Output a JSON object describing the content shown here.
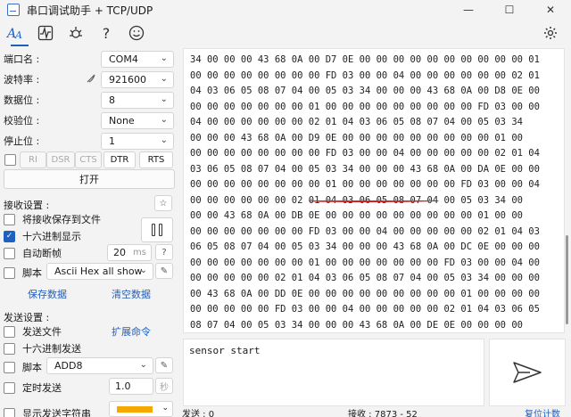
{
  "window": {
    "title": "串口调试助手 + TCP/UDP",
    "minimize": "—",
    "maximize": "☐",
    "close": "✕"
  },
  "toolbar": {
    "text_icon": "AA",
    "wave_icon": "∿",
    "plugin_icon": "✿",
    "help": "?",
    "smile": "☺",
    "settings": "⚙"
  },
  "serial": {
    "port_label": "端口名 :",
    "port_value": "COM4",
    "baud_label": "波特率 :",
    "baud_value": "921600",
    "data_label": "数据位 :",
    "data_value": "8",
    "parity_label": "校验位 :",
    "parity_value": "None",
    "stop_label": "停止位 :",
    "stop_value": "1",
    "ri": "RI",
    "dsr": "DSR",
    "cts": "CTS",
    "dtr": "DTR",
    "rts": "RTS",
    "open_btn": "打开"
  },
  "receive": {
    "title": "接收设置 :",
    "save_to_file": "将接收保存到文件",
    "hex_display": "十六进制显示",
    "auto_frame": "自动断帧",
    "frame_ms": "20",
    "frame_unit": "ms",
    "help": "?",
    "script": "脚本",
    "script_value": "Ascii Hex all show",
    "save_data": "保存数据",
    "clear_data": "清空数据"
  },
  "send": {
    "title": "发送设置 :",
    "send_file": "发送文件",
    "expand_cmd": "扩展命令",
    "hex_send": "十六进制发送",
    "script": "脚本",
    "script_value": "ADD8",
    "timed_send": "定时发送",
    "timed_value": "1.0",
    "timed_unit": "秒",
    "show_send_str": "显示发送字符串",
    "input_text": "sensor start"
  },
  "hex_lines": [
    "34 00 00 00 43 68 0A 00 D7 0E 00 00 00 00 00 00 00 00 00 00 01",
    "00 00 00 00 00 00 00 00 FD 03 00 00 04 00 00 00 00 00 00 02 01",
    "04 03 06 05 08 07 04 00 05 03 34 00 00 00 43 68 0A 00 D8 0E 00",
    "00 00 00 00 00 00 00 01 00 00 00 00 00 00 00 00 00 FD 03 00 00",
    "04 00 00 00 00 00 00 02 01 04 03 06 05 08 07 04 00 05 03 34",
    "00 00 00 43 68 0A 00 D9 0E 00 00 00 00 00 00 00 00 00 01 00",
    "00 00 00 00 00 00 00 00 FD 03 00 00 04 00 00 00 00 00 02 01 04",
    "03 06 05 08 07 04 00 05 03 34 00 00 00 43 68 0A 00 DA 0E 00 00",
    "00 00 00 00 00 00 00 00 01 00 00 00 00 00 00 00 FD 03 00 00 04",
    "00 00 00 00 00 00 02 01 04 03 06 05 08 07 04 00 05 03 34 00",
    "00 00 43 68 0A 00 DB 0E 00 00 00 00 00 00 00 00 00 01 00 00",
    "00 00 00 00 00 00 00 FD 03 00 00 04 00 00 00 00 00 02 01 04 03",
    "06 05 08 07 04 00 05 03 34 00 00 00 43 68 0A 00 DC 0E 00 00 00",
    "00 00 00 00 00 00 00 01 00 00 00 00 00 00 00 FD 03 00 00 04 00",
    "00 00 00 00 00 02 01 04 03 06 05 08 07 04 00 05 03 34 00 00 00",
    "00 43 68 0A 00 DD 0E 00 00 00 00 00 00 00 00 00 01 00 00 00 00",
    "00 00 00 00 00 FD 03 00 00 04 00 00 00 00 00 02 01 04 03 06 05",
    "08 07 04 00 05 03 34 00 00 00 43 68 0A 00 DE 0E 00 00 00 00"
  ],
  "status": {
    "sent": "发送 : 0",
    "received": "接收 : 7873 - 52",
    "reset": "复位计数"
  },
  "colors": {
    "accent": "#1f5fbf",
    "swatch": "#f5a800",
    "annotation": "#d42020"
  }
}
